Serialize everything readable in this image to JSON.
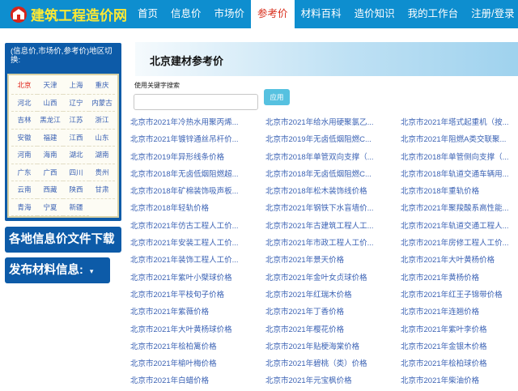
{
  "brand": {
    "name": "建筑工程造价网"
  },
  "nav": {
    "items": [
      "首页",
      "信息价",
      "市场价",
      "参考价",
      "材料百科",
      "造价知识",
      "我的工作台",
      "注册/登录"
    ],
    "active_index": 3
  },
  "sidebar": {
    "region_title": "(信息价,市场价,参考价)地区切换:",
    "regions": [
      "北京",
      "天津",
      "上海",
      "重庆",
      "河北",
      "山西",
      "辽宁",
      "内蒙古",
      "吉林",
      "黑龙江",
      "江苏",
      "浙江",
      "安徽",
      "福建",
      "江西",
      "山东",
      "河南",
      "海南",
      "湖北",
      "湖南",
      "广东",
      "广西",
      "四川",
      "贵州",
      "云南",
      "西藏",
      "陕西",
      "甘肃",
      "青海",
      "宁夏",
      "新疆"
    ],
    "active_region": "北京",
    "download_label": "各地信息价文件下载",
    "publish_label": "发布材料信息:"
  },
  "main": {
    "title": "北京建材参考价",
    "keyword_label": "使用关键字搜索",
    "keyword_value": "",
    "apply_label": "应用",
    "links": [
      "北京市2021年冷热水用聚丙烯...",
      "北京市2021年给水用硬聚氯乙...",
      "北京市2021年塔式起重机（按...",
      "北京市2021年镀锌通丝吊杆价...",
      "北京市2019年无卤低烟阻燃C...",
      "北京市2021年阻燃A类交联聚...",
      "北京市2019年异形线条价格",
      "北京市2018年单管双向支撑（...",
      "北京市2018年单管侧向支撑（...",
      "北京市2018年无卤低烟阻燃超...",
      "北京市2018年无卤低烟阻燃C...",
      "北京市2018年轨道交通车辆用...",
      "北京市2018年矿棉装饰吸声板...",
      "北京市2018年松木装饰线价格",
      "北京市2018年重轨价格",
      "北京市2018年轻轨价格",
      "北京市2021年钢铁下水盲墙价...",
      "北京市2021年聚羧酸系高性能...",
      "北京市2021年仿古工程人工价...",
      "北京市2021年古建筑工程人工...",
      "北京市2021年轨道交通工程人...",
      "北京市2021年安装工程人工价...",
      "北京市2021年市政工程人工价...",
      "北京市2021年房修工程人工价...",
      "北京市2021年装饰工程人工价...",
      "北京市2021年景天价格",
      "北京市2021年大叶黄杨价格",
      "北京市2021年紫叶小檗球价格",
      "北京市2021年金叶女贞球价格",
      "北京市2021年黄杨价格",
      "北京市2021年平枝旬子价格",
      "北京市2021年红瑞木价格",
      "北京市2021年红王子锦带价格",
      "北京市2021年紫薇价格",
      "北京市2021年丁香价格",
      "北京市2021年连翘价格",
      "北京市2021年大叶黄杨球价格",
      "北京市2021年樱花价格",
      "北京市2021年紫叶李价格",
      "北京市2021年桧柏篱价格",
      "北京市2021年贴梗海棠价格",
      "北京市2021年金银木价格",
      "北京市2021年榆叶梅价格",
      "北京市2021年碧桃（类）价格",
      "北京市2021年桧柏球价格",
      "北京市2021年白蜡价格",
      "北京市2021年元宝枫价格",
      "北京市2021年柴油价格"
    ]
  },
  "colors": {
    "nav_bg": "#0e8ecf",
    "brand_text": "#fde933",
    "sidebar_blue": "#0d5ba8",
    "link": "#3b62b4",
    "active_red": "#e0231a",
    "apply_button": "#56c1e0"
  }
}
